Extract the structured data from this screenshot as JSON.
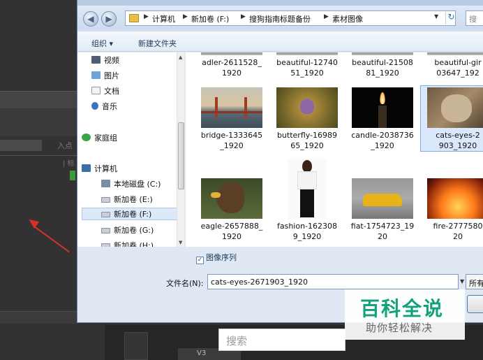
{
  "address_bar": {
    "crumbs": [
      "计算机",
      "新加卷 (F:)",
      "搜狗指南标题备份",
      "素材图像"
    ],
    "search_placeholder": "搜"
  },
  "toolbar": {
    "organize_label": "组织 ▾",
    "new_folder_label": "新建文件夹"
  },
  "nav_pane": {
    "items": [
      {
        "label": "视频",
        "icon": "video-icon"
      },
      {
        "label": "图片",
        "icon": "pictures-icon"
      },
      {
        "label": "文档",
        "icon": "document-icon"
      },
      {
        "label": "音乐",
        "icon": "music-icon"
      },
      {
        "label": "家庭组",
        "icon": "homegroup-icon"
      },
      {
        "label": "计算机",
        "icon": "computer-icon"
      },
      {
        "label": "本地磁盘 (C:)",
        "icon": "drive-icon"
      },
      {
        "label": "新加卷 (E:)",
        "icon": "drive-icon"
      },
      {
        "label": "新加卷 (F:)",
        "icon": "drive-icon",
        "selected": true
      },
      {
        "label": "新加卷 (G:)",
        "icon": "drive-icon"
      },
      {
        "label": "新加卷 (H:)",
        "icon": "drive-icon"
      }
    ]
  },
  "files": [
    {
      "line1": "adler-2611528_",
      "line2": "1920"
    },
    {
      "line1": "beautiful-12740",
      "line2": "51_1920"
    },
    {
      "line1": "beautiful-21508",
      "line2": "81_1920"
    },
    {
      "line1": "beautiful-gir",
      "line2": "03647_192"
    },
    {
      "line1": "bridge-1333645",
      "line2": "_1920"
    },
    {
      "line1": "butterfly-16989",
      "line2": "65_1920"
    },
    {
      "line1": "candle-2038736",
      "line2": "_1920"
    },
    {
      "line1": "cats-eyes-2",
      "line2": "903_1920",
      "selected": true
    },
    {
      "line1": "eagle-2657888_",
      "line2": "1920"
    },
    {
      "line1": "fashion-162308",
      "line2": "9_1920"
    },
    {
      "line1": "fiat-1754723_19",
      "line2": "20"
    },
    {
      "line1": "fire-2777580",
      "line2": "20"
    }
  ],
  "image_sequence": {
    "label": "图像序列",
    "checked": true
  },
  "filename": {
    "label": "文件名(N):",
    "value": "cats-eyes-2671903_1920"
  },
  "file_type": {
    "value": "所有"
  },
  "editor_bg": {
    "in_point_label": "入点",
    "pipe_label": "| 标",
    "track_label": "V3"
  },
  "search_strip": {
    "placeholder": "搜索"
  },
  "watermark": {
    "main": "百科全说",
    "sub": "助你轻松解决"
  },
  "colors": {
    "accent": "#13a07c",
    "selection": "#d9e8fb",
    "arrow": "#d9302a"
  }
}
